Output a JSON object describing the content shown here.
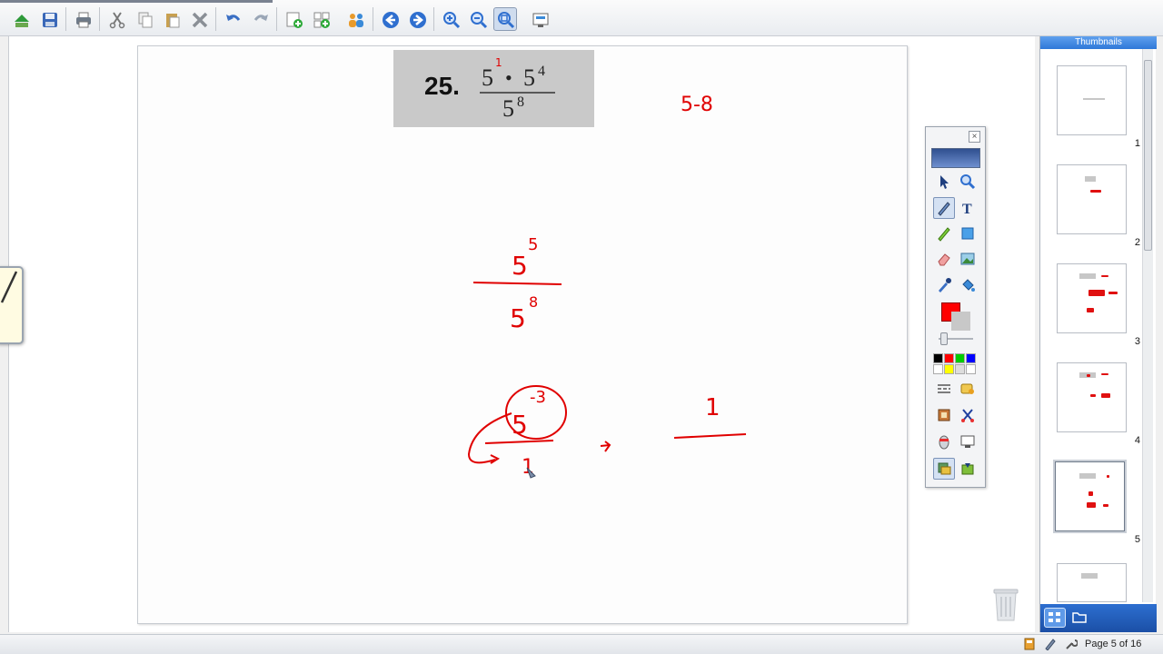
{
  "toolbar": {
    "buttons": [
      {
        "name": "open-icon"
      },
      {
        "name": "save-icon"
      },
      {
        "name": "print-icon"
      },
      {
        "name": "cut-icon"
      },
      {
        "name": "copy-icon"
      },
      {
        "name": "paste-icon"
      },
      {
        "name": "delete-icon"
      },
      {
        "name": "undo-icon"
      },
      {
        "name": "redo-icon"
      },
      {
        "name": "insert-page-icon"
      },
      {
        "name": "insert-pages-icon"
      },
      {
        "name": "share-icon"
      },
      {
        "name": "previous-page-icon"
      },
      {
        "name": "next-page-icon"
      },
      {
        "name": "zoom-in-icon"
      },
      {
        "name": "zoom-out-icon"
      },
      {
        "name": "zoom-fit-icon"
      },
      {
        "name": "screen-capture-icon"
      }
    ],
    "active": "zoom-fit-icon"
  },
  "page": {
    "problem_number": "25.",
    "ink_notes": {
      "top_right": "5-8",
      "fraction_top_base": "5",
      "fraction_top_exp": "5",
      "fraction_bottom_base": "5",
      "fraction_bottom_exp": "8",
      "circled_base": "5",
      "circled_exp": "-3",
      "result_numerator": "1",
      "bottom_left_one": "1"
    },
    "printed_expression": {
      "base1": "5",
      "dot": "•",
      "base2": "5",
      "exp2": "4",
      "denominator_base": "5",
      "denominator_exp": "8",
      "added_exp": "1"
    }
  },
  "tools": {
    "ink_color": "#ff0000",
    "swatches": [
      "#000000",
      "#ff0000",
      "#00cc00",
      "#0000ff",
      "#ffffff",
      "#ffff00",
      "#dddddd",
      "#ffffff"
    ]
  },
  "thumbnails": {
    "header": "Thumbnails",
    "pages": [
      "1",
      "2",
      "3",
      "4",
      "5"
    ],
    "selected": "5"
  },
  "status": {
    "page_text": "Page 5 of 16"
  }
}
